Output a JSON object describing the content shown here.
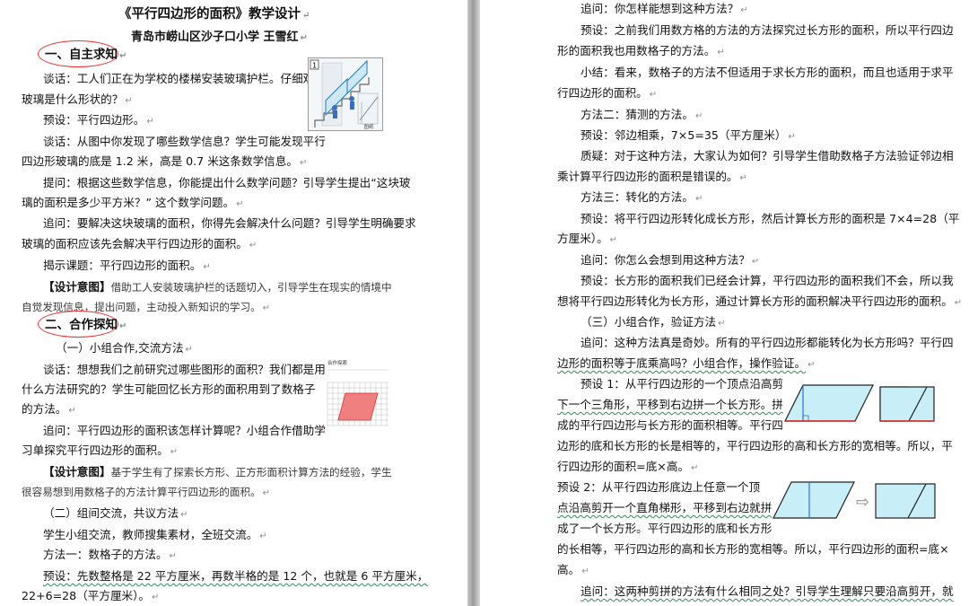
{
  "left": {
    "title": "《平行四边形的面积》教学设计",
    "author": "青岛市崂山区沙子口小学  王雪红",
    "sec1": "一、自主求知",
    "l1": "谈话：工人们正在为学校的楼梯安装玻璃护栏。仔细观察",
    "l2": "玻璃是什么形状的？",
    "l3": "预设：平行四边形。",
    "l4": "谈话：从图中你发现了哪些数学信息？学生可能发现平行",
    "l5": "四边形玻璃的底是 1.2 米，高是 0.7 米这条数学信息。",
    "l6": "提问：根据这些数学信息，你能提出什么数学问题？引导学生提出“这块玻",
    "l7": "璃的面积是多少平方米？” 这个数学问题。",
    "l8": "追问：要解决这块玻璃的面积，你得先会解决什么问题？引导学生明确要求",
    "l9": "玻璃的面积应该先会解决平行四边形的面积。",
    "l10": "揭示课题：平行四边形的面积。",
    "d1_label": "【设计意图】",
    "d1a": "借助工人安装玻璃护栏的话题切入，引导学生在现实的情境中",
    "d1b": "自觉发现信息，提出问题，主动投入新知识的学习。",
    "sec2": "二、合作探知",
    "sub1": "（一）小组合作,交流方法",
    "l11": "谈话：想想我们之前研究过哪些图形的面积？我们都是用",
    "l12": "什么方法研究的？学生可能回忆长方形的面积用到了数格子",
    "l13": "的方法。",
    "l14": "追问：平行四边形的面积该怎样计算呢？小组合作借助学",
    "l15": "习单探究平行四边形的面积。",
    "d2_label": "【设计意图】",
    "d2a": "基于学生有了探索长方形、正方形面积计算方法的经验，学生",
    "d2b": "很容易想到用数格子的方法计算平行四边形的面积。",
    "sub2": "（二）组间交流，共议方法",
    "l16": "学生小组交流，教师搜集素材，全班交流。",
    "l17": "方法一：数格子的方法。",
    "l18": "预设：先数整格是 22 平方厘米，再数半格的是 12 个，也就是 6 平方厘米，",
    "l19": "22+6=28（平方厘米）。",
    "fig1_number": "1",
    "fig1_caption": "图纸",
    "fig2_caption": "合作探索"
  },
  "right": {
    "r1": "追问：你怎样能想到这种方法？",
    "r2": "预设：之前我们用数方格的方法的方法探究过长方形的面积，所以平行四边",
    "r3": "形的面积我也用数格子的方法。",
    "r4": "小结：看来，数格子的方法不但适用于求长方形的面积，而且也适用于求平",
    "r5": "行四边形的面积。",
    "r6": "方法二：猜测的方法。",
    "r7": "预设：邻边相乘，7×5=35（平方厘米）",
    "r8": "质疑：对于这种方法，大家认为如何？引导学生借助数格子方法验证邻边相",
    "r9": "乘计算平行四边形的面积是错误的。",
    "r10": "方法三：转化的方法。",
    "r11": "预设：将平行四边形转化成长方形，然后计算长方形的面积是 7×4=28（平",
    "r12": "方厘米）。",
    "r13": "追问：你怎么会想到用这种方法？",
    "r14": "预设：长方形的面积我们已经会计算，平行四边形的面积我们不会，所以我",
    "r15": "想将平行四边形转化为长方形，通过计算长方形的面积解决平行四边形的面积。",
    "sub3": "（三）小组合作，验证方法",
    "r16": "追问：这种方法真是奇妙。所有的平行四边形都能转化为长方形吗？平行四",
    "r17": "边形的面积等于底乘高吗？小组合作，操作验证。",
    "p1a": "预设 1：从平行四边形的一个顶点沿高剪",
    "p1b": "下一个三角形，平移到右边拼一个长方形。拼",
    "p1c": "成的平行四边形与长方形的面积相等。平行四",
    "p1d": "边形的底和长方形的长是相等的，平行四边形的高和长方形的宽相等。所以，平",
    "p1e": "行四边形的面积=底×高。",
    "p2a": "预设 2：从平行四边形底边上任意一个顶",
    "p2b": "点沿高剪开一个直角梯形，平移到右边就拼",
    "p2c": "成了一个长方形。平行四边形的底和长方形",
    "p2d": "的长相等，平行四边形的高和长方形的宽相等。所以，平行四边形的面积=底×",
    "p2e": "高。",
    "r18": "追问：这两种剪拼的方法有什么相同之处？引导学生理解只要沿高剪开，就"
  },
  "return_mark": "↵",
  "colors": {
    "shape_fill": "#c8eef7",
    "annotation_circle": "#e33333",
    "grid_parallelogram": "#f08080"
  }
}
